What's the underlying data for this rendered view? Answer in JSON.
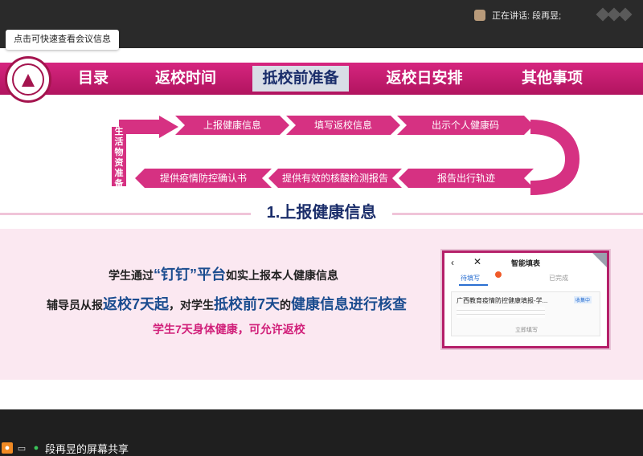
{
  "meeting": {
    "speaking_label": "正在讲话: 段再昱;",
    "tooltip": "点击可快速查看会议信息",
    "share_label": "段再昱的屏幕共享"
  },
  "slide": {
    "nav": [
      "目录",
      "返校时间",
      "抵校前准备",
      "返校日安排",
      "其他事项"
    ],
    "flow_top": [
      "上报健康信息",
      "填写返校信息",
      "出示个人健康码"
    ],
    "flow_bottom": [
      "提供疫情防控确认书",
      "提供有效的核酸检测报告",
      "报告出行轨迹"
    ],
    "flow_side": "生活物资准备",
    "section_title": "1.上报健康信息",
    "line1": {
      "a": "学生通过",
      "b": "“钉钉”平台",
      "c": "如实上报本人健康信息"
    },
    "line2": {
      "a": "辅导员从报",
      "b": "返校7天起",
      "c": "，对学生",
      "d": "抵校前7天",
      "e": "的",
      "f": "健康信息进行核查"
    },
    "line3": "学生7天身体健康，可允许返校",
    "phone": {
      "title": "智能填表",
      "tab_pending": "待填写",
      "tab_done": "已完成",
      "card_title": "广西教育疫情防控健康填报-学...",
      "tag": "收集中",
      "action": "立即填写"
    }
  },
  "colors": {
    "brand": "#c41a6e",
    "navy": "#1b2e6b",
    "pink_bg": "#fbe8f1"
  },
  "icons": {
    "back": "chevron-left-icon",
    "close": "close-icon",
    "person": "person-icon",
    "screen": "screen-share-icon",
    "mic": "mic-icon"
  }
}
